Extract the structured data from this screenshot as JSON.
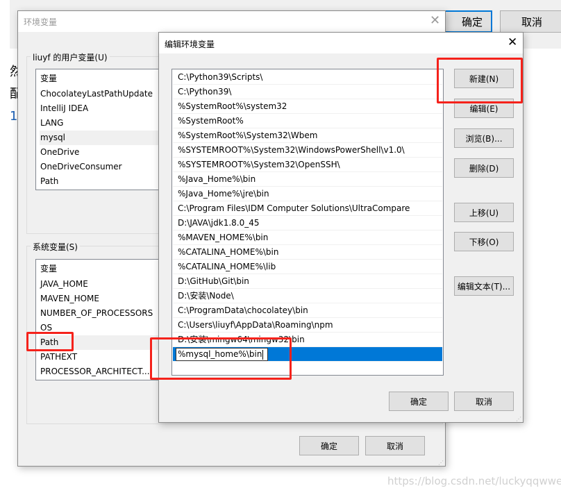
{
  "background": {
    "side_chars": [
      "然",
      "配",
      "1"
    ],
    "ok_label": "确定",
    "cancel_label": "取消"
  },
  "env_dialog": {
    "title": "环境变量",
    "user_group_label": "liuyf 的用户变量(U)",
    "user_list_header": "变量",
    "user_vars": [
      "ChocolateyLastPathUpdate",
      "IntelliJ IDEA",
      "LANG",
      "mysql",
      "OneDrive",
      "OneDriveConsumer",
      "Path"
    ],
    "user_selected": "mysql",
    "system_group_label": "系统变量(S)",
    "system_list_header": "变量",
    "system_vars": [
      "JAVA_HOME",
      "MAVEN_HOME",
      "NUMBER_OF_PROCESSORS",
      "OS",
      "Path",
      "PATHEXT",
      "PROCESSOR_ARCHITECT..."
    ],
    "system_selected": "Path",
    "ok_label": "确定",
    "cancel_label": "取消"
  },
  "edit_dialog": {
    "title": "编辑环境变量",
    "paths": [
      "C:\\Python39\\Scripts\\",
      "C:\\Python39\\",
      "%SystemRoot%\\system32",
      "%SystemRoot%",
      "%SystemRoot%\\System32\\Wbem",
      "%SYSTEMROOT%\\System32\\WindowsPowerShell\\v1.0\\",
      "%SYSTEMROOT%\\System32\\OpenSSH\\",
      "%Java_Home%\\bin",
      "%Java_Home%\\jre\\bin",
      "C:\\Program Files\\IDM Computer Solutions\\UltraCompare",
      "D:\\JAVA\\jdk1.8.0_45",
      "%MAVEN_HOME%\\bin",
      "%CATALINA_HOME%\\bin",
      "%CATALINA_HOME%\\lib",
      "D:\\GitHub\\Git\\bin",
      "D:\\安装\\Node\\",
      "C:\\ProgramData\\chocolatey\\bin",
      "C:\\Users\\liuyf\\AppData\\Roaming\\npm",
      "D:\\安装\\mingw64\\mingw32\\bin"
    ],
    "editing_value": "%mysql_home%\\bin",
    "buttons": {
      "new": "新建(N)",
      "edit": "编辑(E)",
      "browse": "浏览(B)...",
      "delete": "删除(D)",
      "up": "上移(U)",
      "down": "下移(O)",
      "edit_text": "编辑文本(T)..."
    },
    "ok_label": "确定",
    "cancel_label": "取消"
  },
  "watermark": "https://blog.csdn.net/luckyqqwwee",
  "colors": {
    "selection": "#0078d7",
    "highlight_box": "#f5221b",
    "dialog_bg": "#f0f0f0"
  }
}
